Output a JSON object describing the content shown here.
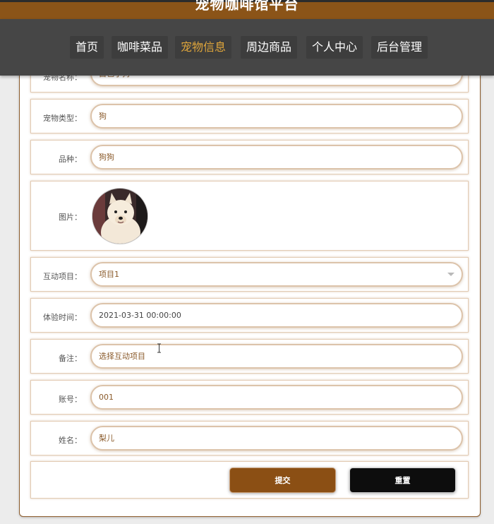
{
  "site": {
    "title": "宠物咖啡馆平台",
    "brand_color": "#8b5418",
    "nav_bg": "#464646",
    "active_color": "#e0a63b"
  },
  "nav": {
    "items": [
      {
        "label": "首页",
        "active": false
      },
      {
        "label": "咖啡菜品",
        "active": false
      },
      {
        "label": "宠物信息",
        "active": true
      },
      {
        "label": "周边商品",
        "active": false
      },
      {
        "label": "个人中心",
        "active": false
      },
      {
        "label": "后台管理",
        "active": false
      }
    ]
  },
  "form": {
    "pet_name": {
      "label": "宠物名称：",
      "value": "白色小狗"
    },
    "pet_type": {
      "label": "宠物类型：",
      "value": "狗"
    },
    "breed": {
      "label": "品种：",
      "value": "狗狗"
    },
    "image": {
      "label": "图片："
    },
    "interaction": {
      "label": "互动项目：",
      "value": "项目1"
    },
    "experience_time": {
      "label": "体验时间：",
      "value": "2021-03-31 00:00:00"
    },
    "note": {
      "label": "备注：",
      "value": "选择互动项目"
    },
    "account": {
      "label": "账号：",
      "value": "001"
    },
    "name": {
      "label": "姓名：",
      "value": "梨儿"
    },
    "submit_label": "提交",
    "reset_label": "重置",
    "submit_color": "#8b4f14",
    "reset_color": "#0d0d0d"
  }
}
